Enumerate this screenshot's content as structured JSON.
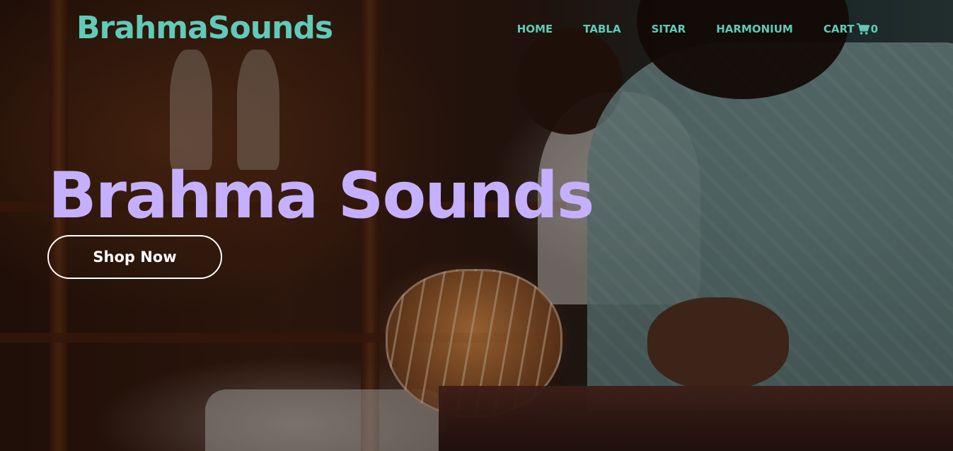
{
  "header": {
    "logo": "BrahmaSounds",
    "nav": [
      {
        "label": "HOME"
      },
      {
        "label": "TABLA"
      },
      {
        "label": "SITAR"
      },
      {
        "label": "HARMONIUM"
      }
    ],
    "cart": {
      "label": "CART",
      "icon": "shopping-cart-icon",
      "count": "0"
    }
  },
  "hero": {
    "title": "Brahma Sounds",
    "cta_label": "Shop Now",
    "background": "video-still-musicians-playing-tabla-and-harmonium"
  },
  "colors": {
    "logo": "#5fcbb8",
    "nav": "#5fcbb8",
    "headline": "#c4b0ff",
    "cta_border": "#ffffff"
  }
}
